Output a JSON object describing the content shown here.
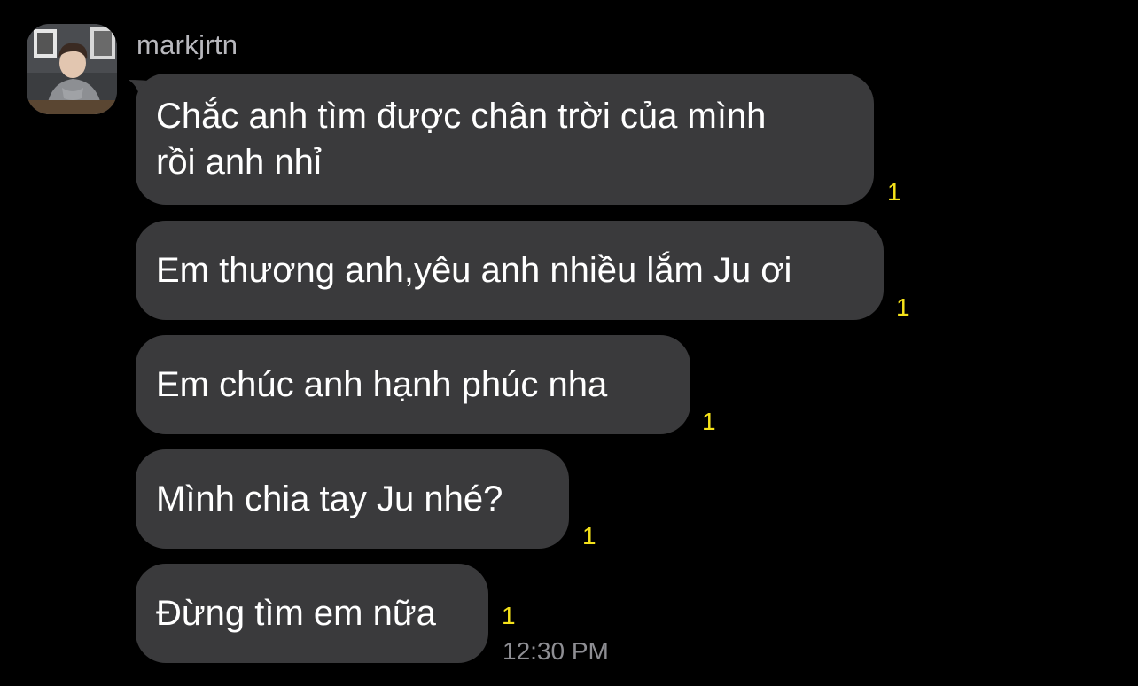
{
  "conversation": {
    "sender_name": "markjrtn",
    "avatar": "profile-photo",
    "messages": [
      {
        "text_lines": [
          "Chắc anh tìm được chân trời của mình",
          "rồi anh nhỉ"
        ],
        "unread": "1"
      },
      {
        "text": "Em thương anh,yêu anh nhiều lắm Ju ơi",
        "unread": "1"
      },
      {
        "text": "Em chúc anh hạnh phúc nha",
        "unread": "1"
      },
      {
        "text": "Mình chia tay Ju nhé?",
        "unread": "1"
      },
      {
        "text": "Đừng tìm em nữa",
        "unread": "1"
      }
    ],
    "timestamp": "12:30 PM"
  },
  "colors": {
    "background": "#000000",
    "bubble": "#3a3a3c",
    "text": "#ffffff",
    "unread": "#f5e21a",
    "timestamp": "#8e8e93"
  }
}
